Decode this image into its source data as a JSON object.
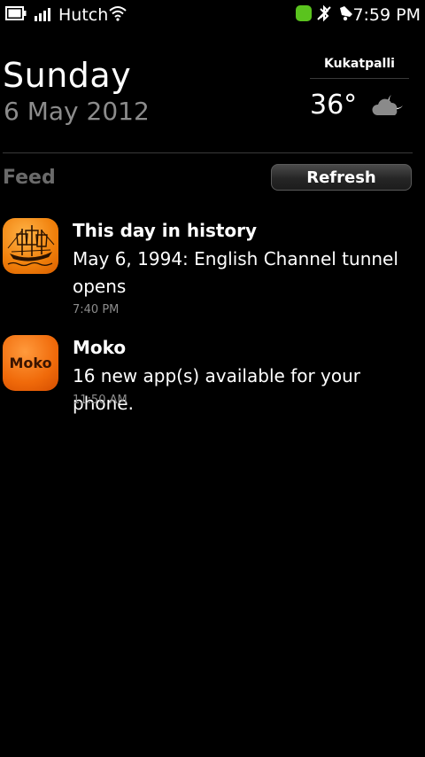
{
  "status_bar": {
    "carrier": "Hutch",
    "time": "7:59 PM",
    "icons": [
      "battery-icon",
      "signal-icon",
      "wifi-icon",
      "app-running-icon",
      "bluetooth-off-icon",
      "alarm-icon"
    ],
    "app_indicator_color": "#5ac31e"
  },
  "header": {
    "day": "Sunday",
    "date": "6 May 2012"
  },
  "weather": {
    "location": "Kukatpalli",
    "temperature": "36°",
    "icon": "partly-cloudy-night-icon"
  },
  "feed": {
    "label": "Feed",
    "refresh_label": "Refresh",
    "items": [
      {
        "icon": "history-ship-icon",
        "title": "This day in history",
        "body": "May 6, 1994: English Channel tunnel opens",
        "time": "7:40 PM"
      },
      {
        "icon": "moko-icon",
        "icon_text": "Moko",
        "title": "Moko",
        "body": "16 new app(s) available for your phone.",
        "time": "11:50 AM"
      }
    ]
  }
}
